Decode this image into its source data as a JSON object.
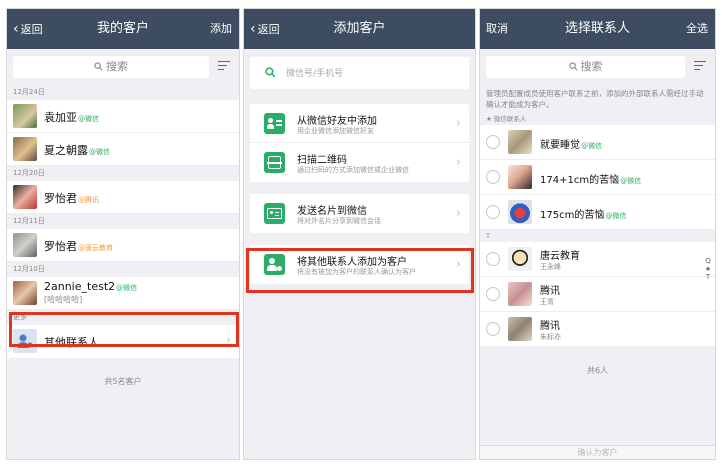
{
  "screen1": {
    "back_label": "返回",
    "title": "我的客户",
    "action_label": "添加",
    "search_placeholder": "搜索",
    "sections": [
      {
        "label": "12月24日"
      },
      {
        "label": "12月20日"
      },
      {
        "label": "12月11日"
      },
      {
        "label": "12月10日"
      },
      {
        "label": "更多"
      }
    ],
    "contacts": [
      {
        "name": "袁加亚",
        "tag": "@微信"
      },
      {
        "name": "夏之朝露",
        "tag": "@微信"
      },
      {
        "name": "罗怡君",
        "tag": "@腾讯"
      },
      {
        "name": "罗怡君",
        "tag": "@唐云教育"
      },
      {
        "name": "2annie_test2",
        "tag": "@微信",
        "note": "[哈哈哈哈]"
      }
    ],
    "more_item": "其他联系人",
    "count": "共5名客户"
  },
  "screen2": {
    "back_label": "返回",
    "title": "添加客户",
    "search_placeholder": "微信号/手机号",
    "options": [
      {
        "title": "从微信好友中添加",
        "subtitle": "用企业微信添加微信好友"
      },
      {
        "title": "扫描二维码",
        "subtitle": "通过扫码的方式添加微信或企业微信"
      },
      {
        "title": "发送名片到微信",
        "subtitle": "将对外名片分享到微信会话"
      },
      {
        "title": "将其他联系人添加为客户",
        "subtitle": "将没有被加为客户的联系人确认为客户"
      }
    ]
  },
  "screen3": {
    "cancel_label": "取消",
    "title": "选择联系人",
    "select_all_label": "全选",
    "search_placeholder": "搜索",
    "hint": "管理员配置成员使用客户联系之前，添加的外部联系人需经过手动确认才能成为客户。",
    "section_wechat": "★ 微信联系人",
    "wechat_contacts": [
      {
        "name": "就要睡觉",
        "tag": "@微信"
      },
      {
        "name": "174+1cm的苦恼",
        "tag": "@微信"
      },
      {
        "name": "175cm的苦恼",
        "tag": "@微信"
      }
    ],
    "section_t": "T",
    "t_contacts": [
      {
        "name": "唐云教育",
        "sub": "王永峰"
      },
      {
        "name": "腾讯",
        "sub": "王青"
      },
      {
        "name": "腾讯",
        "sub": "朱标亦"
      }
    ],
    "count": "共6人",
    "index": [
      "Q",
      "★",
      "T"
    ],
    "bottom_label": "确认为客户"
  },
  "colors": {
    "navbar": "#3d4c60",
    "wechat_green": "#2aae67",
    "highlight_red": "#e03320",
    "tag_orange": "#f19a38"
  }
}
